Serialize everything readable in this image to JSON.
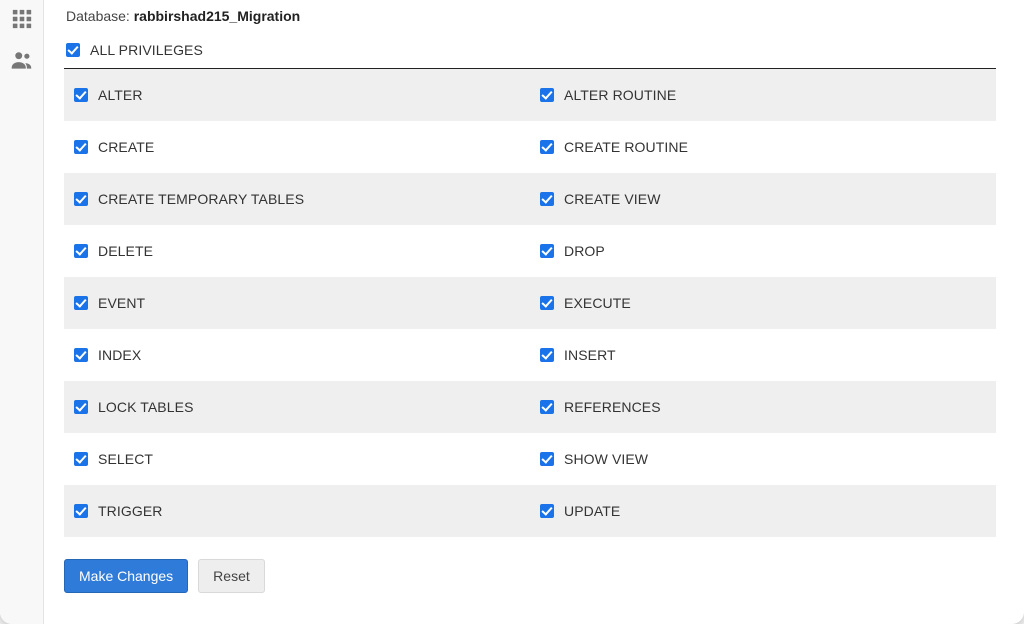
{
  "sidebar": {
    "icons": [
      "grid-icon",
      "users-icon"
    ]
  },
  "header": {
    "database_label": "Database: ",
    "database_name": "rabbirshad215_Migration"
  },
  "all_privileges": {
    "label": "ALL PRIVILEGES",
    "checked": true
  },
  "privileges": [
    {
      "left": {
        "label": "ALTER",
        "checked": true
      },
      "right": {
        "label": "ALTER ROUTINE",
        "checked": true
      }
    },
    {
      "left": {
        "label": "CREATE",
        "checked": true
      },
      "right": {
        "label": "CREATE ROUTINE",
        "checked": true
      }
    },
    {
      "left": {
        "label": "CREATE TEMPORARY TABLES",
        "checked": true
      },
      "right": {
        "label": "CREATE VIEW",
        "checked": true
      }
    },
    {
      "left": {
        "label": "DELETE",
        "checked": true
      },
      "right": {
        "label": "DROP",
        "checked": true
      }
    },
    {
      "left": {
        "label": "EVENT",
        "checked": true
      },
      "right": {
        "label": "EXECUTE",
        "checked": true
      }
    },
    {
      "left": {
        "label": "INDEX",
        "checked": true
      },
      "right": {
        "label": "INSERT",
        "checked": true
      }
    },
    {
      "left": {
        "label": "LOCK TABLES",
        "checked": true
      },
      "right": {
        "label": "REFERENCES",
        "checked": true
      }
    },
    {
      "left": {
        "label": "SELECT",
        "checked": true
      },
      "right": {
        "label": "SHOW VIEW",
        "checked": true
      }
    },
    {
      "left": {
        "label": "TRIGGER",
        "checked": true
      },
      "right": {
        "label": "UPDATE",
        "checked": true
      }
    }
  ],
  "actions": {
    "make_changes": "Make Changes",
    "reset": "Reset"
  }
}
